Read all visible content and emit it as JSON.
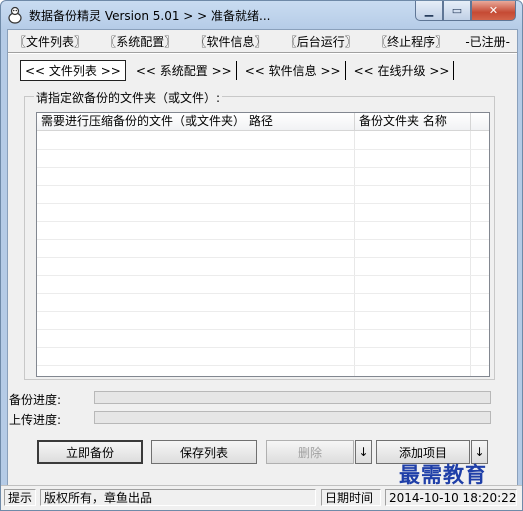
{
  "window": {
    "title": "数据备份精灵   Version 5.01   > > 准备就绪..."
  },
  "menu": [
    "〖文件列表〗",
    "〖系统配置〗",
    "〖软件信息〗",
    "〖后台运行〗",
    "〖终止程序〗",
    "-已注册-"
  ],
  "tabs": [
    "<< 文件列表 >>",
    "<< 系统配置 >>",
    "<< 软件信息 >>",
    "<< 在线升级 >>"
  ],
  "group": {
    "label": "请指定欲备份的文件夹（或文件）:"
  },
  "list": {
    "columns": [
      "需要进行压缩备份的文件（或文件夹）  路径",
      "备份文件夹  名称"
    ],
    "rows": []
  },
  "progress": {
    "backup_label": "备份进度:",
    "backup_value": 0,
    "upload_label": "上传进度:",
    "upload_value": 0
  },
  "buttons": {
    "backup_now": "立即备份",
    "save_list": "保存列表",
    "delete": "删除",
    "delete_arrow": "↓",
    "add_item": "添加项目",
    "add_arrow": "↓"
  },
  "status": {
    "hint": "提示",
    "copyright": "版权所有，章鱼出品",
    "date_label": "日期时间",
    "datetime": "2014-10-10 18:20:22"
  },
  "watermark": "最需教育",
  "icons": {
    "app": "app-icon",
    "minimize": "minimize-icon",
    "maximize": "maximize-icon",
    "close": "close-icon"
  }
}
